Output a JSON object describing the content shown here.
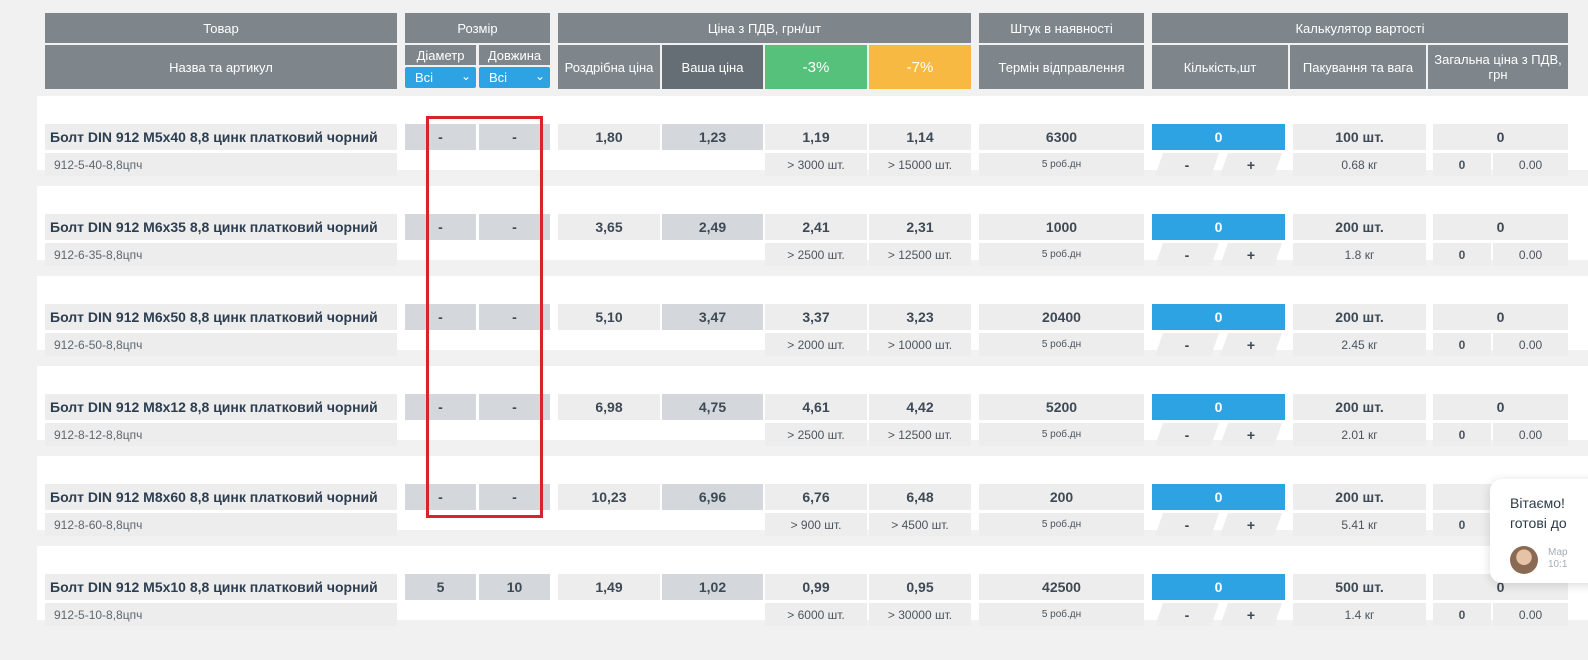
{
  "header": {
    "product_group": "Товар",
    "size_group": "Розмір",
    "price_group": "Ціна з ПДВ, грн/шт",
    "stock_group": "Штук в наявності",
    "calc_group": "Калькулятор вартості",
    "name_col": "Назва та артикул",
    "diameter_col": "Діаметр",
    "length_col": "Довжина",
    "diameter_filter": "Всі",
    "length_filter": "Всі",
    "retail_col": "Роздрібна ціна",
    "your_price_col": "Ваша ціна",
    "disc3_col": "-3%",
    "disc7_col": "-7%",
    "ship_col": "Термін відправлення",
    "qty_col": "Кількість,шт",
    "pack_col": "Пакування та вага",
    "total_col": "Загальна ціна з ПДВ, грн"
  },
  "rows": [
    {
      "name": "Болт DIN 912 M5х40 8,8 цинк платковий чорний",
      "article": "912-5-40-8,8цпч",
      "diameter": "-",
      "length": "-",
      "retail": "1,80",
      "your_price": "1,23",
      "p3": "1,19",
      "p7": "1,14",
      "p3_min": "> 3000 шт.",
      "p7_min": "> 15000 шт.",
      "stock": "6300",
      "ship": "5 роб.дн",
      "qty": "0",
      "minus": "-",
      "plus": "+",
      "pack": "100 шт.",
      "weight": "0.68 кг",
      "total": "0",
      "total_a": "0",
      "total_b": "0.00"
    },
    {
      "name": "Болт DIN 912 M6х35 8,8 цинк платковий чорний",
      "article": "912-6-35-8,8цпч",
      "diameter": "-",
      "length": "-",
      "retail": "3,65",
      "your_price": "2,49",
      "p3": "2,41",
      "p7": "2,31",
      "p3_min": "> 2500 шт.",
      "p7_min": "> 12500 шт.",
      "stock": "1000",
      "ship": "5 роб.дн",
      "qty": "0",
      "minus": "-",
      "plus": "+",
      "pack": "200 шт.",
      "weight": "1.8 кг",
      "total": "0",
      "total_a": "0",
      "total_b": "0.00"
    },
    {
      "name": "Болт DIN 912 M6х50 8,8 цинк платковий чорний",
      "article": "912-6-50-8,8цпч",
      "diameter": "-",
      "length": "-",
      "retail": "5,10",
      "your_price": "3,47",
      "p3": "3,37",
      "p7": "3,23",
      "p3_min": "> 2000 шт.",
      "p7_min": "> 10000 шт.",
      "stock": "20400",
      "ship": "5 роб.дн",
      "qty": "0",
      "minus": "-",
      "plus": "+",
      "pack": "200 шт.",
      "weight": "2.45 кг",
      "total": "0",
      "total_a": "0",
      "total_b": "0.00"
    },
    {
      "name": "Болт DIN 912 M8х12 8,8 цинк платковий чорний",
      "article": "912-8-12-8,8цпч",
      "diameter": "-",
      "length": "-",
      "retail": "6,98",
      "your_price": "4,75",
      "p3": "4,61",
      "p7": "4,42",
      "p3_min": "> 2500 шт.",
      "p7_min": "> 12500 шт.",
      "stock": "5200",
      "ship": "5 роб.дн",
      "qty": "0",
      "minus": "-",
      "plus": "+",
      "pack": "200 шт.",
      "weight": "2.01 кг",
      "total": "0",
      "total_a": "0",
      "total_b": "0.00"
    },
    {
      "name": "Болт DIN 912 M8х60 8,8 цинк платковий чорний",
      "article": "912-8-60-8,8цпч",
      "diameter": "-",
      "length": "-",
      "retail": "10,23",
      "your_price": "6,96",
      "p3": "6,76",
      "p7": "6,48",
      "p3_min": "> 900 шт.",
      "p7_min": "> 4500 шт.",
      "stock": "200",
      "ship": "5 роб.дн",
      "qty": "0",
      "minus": "-",
      "plus": "+",
      "pack": "200 шт.",
      "weight": "5.41 кг",
      "total": "",
      "total_a": "0",
      "total_b": ""
    },
    {
      "name": "Болт DIN 912 M5х10 8,8 цинк платковий чорний",
      "article": "912-5-10-8,8цпч",
      "diameter": "5",
      "length": "10",
      "retail": "1,49",
      "your_price": "1,02",
      "p3": "0,99",
      "p7": "0,95",
      "p3_min": "> 6000 шт.",
      "p7_min": "> 30000 шт.",
      "stock": "42500",
      "ship": "5 роб.дн",
      "qty": "0",
      "minus": "-",
      "plus": "+",
      "pack": "500 шт.",
      "weight": "1.4 кг",
      "total": "0",
      "total_a": "0",
      "total_b": "0.00"
    }
  ],
  "chat": {
    "line1": "Вітаємо!",
    "line2": "готові до",
    "agent": "Мар",
    "time": "10:1"
  }
}
